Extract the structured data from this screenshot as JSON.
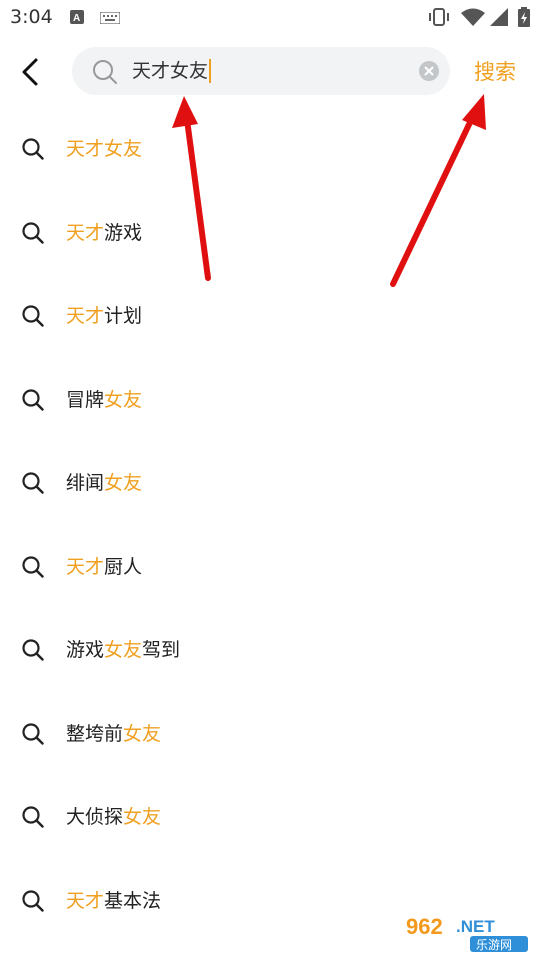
{
  "status_bar": {
    "time": "3:04"
  },
  "search": {
    "query": "天才女友",
    "button_label": "搜索"
  },
  "suggestions": [
    {
      "segments": [
        {
          "text": "天才女友",
          "hl": true
        }
      ]
    },
    {
      "segments": [
        {
          "text": "天才",
          "hl": true
        },
        {
          "text": "游戏",
          "hl": false
        }
      ]
    },
    {
      "segments": [
        {
          "text": "天才",
          "hl": true
        },
        {
          "text": "计划",
          "hl": false
        }
      ]
    },
    {
      "segments": [
        {
          "text": "冒牌",
          "hl": false
        },
        {
          "text": "女友",
          "hl": true
        }
      ]
    },
    {
      "segments": [
        {
          "text": "绯闻",
          "hl": false
        },
        {
          "text": "女友",
          "hl": true
        }
      ]
    },
    {
      "segments": [
        {
          "text": "天才",
          "hl": true
        },
        {
          "text": "厨人",
          "hl": false
        }
      ]
    },
    {
      "segments": [
        {
          "text": "游戏",
          "hl": false
        },
        {
          "text": "女友",
          "hl": true
        },
        {
          "text": "驾到",
          "hl": false
        }
      ]
    },
    {
      "segments": [
        {
          "text": "整垮前",
          "hl": false
        },
        {
          "text": "女友",
          "hl": true
        }
      ]
    },
    {
      "segments": [
        {
          "text": "大侦探",
          "hl": false
        },
        {
          "text": "女友",
          "hl": true
        }
      ]
    },
    {
      "segments": [
        {
          "text": "天才",
          "hl": true
        },
        {
          "text": "基本法",
          "hl": false
        }
      ]
    }
  ],
  "watermark": {
    "brand_number": "962",
    "brand_suffix": ".NET",
    "sub": "乐游网"
  },
  "colors": {
    "accent": "#f0a020",
    "arrow": "#e01010",
    "search_bg": "#f1f3f5"
  },
  "icons": [
    "back-arrow-icon",
    "search-icon",
    "clear-icon",
    "vibrate-icon",
    "wifi-icon",
    "signal-icon",
    "battery-icon"
  ]
}
